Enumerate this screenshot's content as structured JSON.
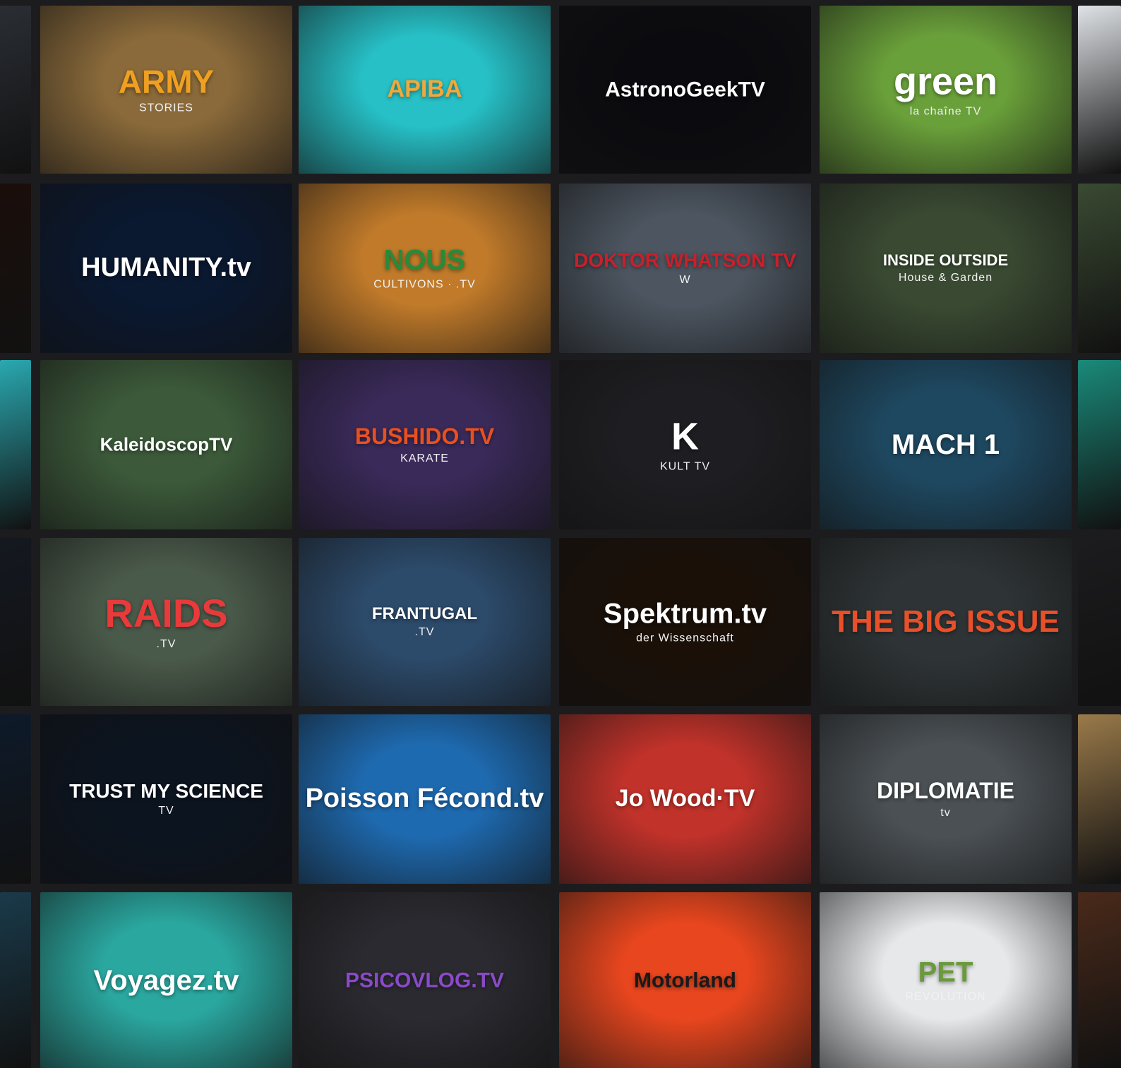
{
  "channels": [
    {
      "name": "ARMY",
      "sub": "STORIES",
      "bg": "#8a6a3a",
      "accent": "#f0a020"
    },
    {
      "name": "APIBA",
      "sub": "",
      "bg": "#26c0c6",
      "accent": "#f2a83a"
    },
    {
      "name": "AstronoGeekTV",
      "sub": "",
      "bg": "#0b0b0f",
      "accent": "#ffffff"
    },
    {
      "name": "green",
      "sub": "la chaîne TV",
      "bg": "#6aa03a",
      "accent": "#ffffff"
    },
    {
      "name": "HUMANITY.tv",
      "sub": "",
      "bg": "#0a1830",
      "accent": "#ffffff"
    },
    {
      "name": "NOUS",
      "sub": "CULTIVONS · .TV",
      "bg": "#c07a2a",
      "accent": "#2a8a3a"
    },
    {
      "name": "DOKTOR WHATSON TV",
      "sub": "W",
      "bg": "#4c5560",
      "accent": "#c8202a"
    },
    {
      "name": "INSIDE OUTSIDE",
      "sub": "House & Garden",
      "bg": "#3a4a32",
      "accent": "#ffffff"
    },
    {
      "name": "KaleidoscopTV",
      "sub": "",
      "bg": "#3c5a3a",
      "accent": "#ffffff"
    },
    {
      "name": "BUSHIDO.TV",
      "sub": "KARATE",
      "bg": "#3a2a5a",
      "accent": "#e85020"
    },
    {
      "name": "K",
      "sub": "KULT TV",
      "bg": "#1e1e22",
      "accent": "#ffffff"
    },
    {
      "name": "MACH 1",
      "sub": "",
      "bg": "#1e4860",
      "accent": "#ffffff"
    },
    {
      "name": "RAIDS",
      "sub": ".TV",
      "bg": "#4a5a4a",
      "accent": "#e83a3a"
    },
    {
      "name": "FRANTUGAL",
      "sub": ".TV",
      "bg": "#2c4a6a",
      "accent": "#ffffff"
    },
    {
      "name": "Spektrum.tv",
      "sub": "der Wissenschaft",
      "bg": "#1a1008",
      "accent": "#ffffff"
    },
    {
      "name": "THE BIG ISSUE",
      "sub": "",
      "bg": "#2e3436",
      "accent": "#e8502a"
    },
    {
      "name": "TRUST MY SCIENCE",
      "sub": "TV",
      "bg": "#0c1420",
      "accent": "#ffffff"
    },
    {
      "name": "Poisson Fécond.tv",
      "sub": "",
      "bg": "#1e6ab0",
      "accent": "#ffffff"
    },
    {
      "name": "Jo Wood·TV",
      "sub": "",
      "bg": "#c0322a",
      "accent": "#ffffff"
    },
    {
      "name": "DIPLOMATIE",
      "sub": "tv",
      "bg": "#4a5054",
      "accent": "#ffffff"
    },
    {
      "name": "Voyagez.tv",
      "sub": "",
      "bg": "#2aa8a0",
      "accent": "#ffffff"
    },
    {
      "name": "PSICOVLOG.TV",
      "sub": "",
      "bg": "#2a2a30",
      "accent": "#8a4ac8"
    },
    {
      "name": "Motorland",
      "sub": "",
      "bg": "#e8461e",
      "accent": "#1a1a1a"
    },
    {
      "name": "PET",
      "sub": "REVOLUTION",
      "bg": "#e6e8ea",
      "accent": "#6a9a3a"
    }
  ],
  "edge_colors": {
    "left": [
      "#2a2e34",
      "#1a0e0a",
      "#2aa8b0",
      "#141820",
      "#0e1a2a",
      "#1a3a4a"
    ],
    "right": [
      "#dfe2e6",
      "#3a4a32",
      "#1a8a7a",
      "#1c1c1e",
      "#9a7a4a",
      "#4a2a1a"
    ]
  }
}
